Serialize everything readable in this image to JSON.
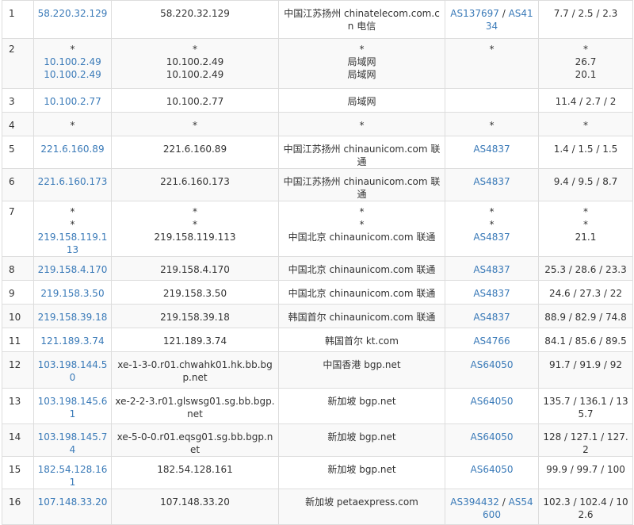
{
  "rows": [
    {
      "hop": "1",
      "ips": [
        "58.220.32.129"
      ],
      "hosts": [
        "58.220.32.129"
      ],
      "locs": [
        "中国江苏扬州 chinatelecom.com.cn 电信"
      ],
      "asns": [
        [
          "AS137697",
          "AS4134"
        ]
      ],
      "rtts": [
        "7.7 / 2.5 / 2.3"
      ]
    },
    {
      "hop": "2",
      "ips": [
        "*",
        "10.100.2.49",
        "10.100.2.49"
      ],
      "hosts": [
        "*",
        "10.100.2.49",
        "10.100.2.49"
      ],
      "locs": [
        "*",
        "局域网",
        "局域网"
      ],
      "asns": [
        [
          "*"
        ]
      ],
      "rtts": [
        "*",
        "26.7",
        "20.1"
      ]
    },
    {
      "hop": "3",
      "ips": [
        "10.100.2.77"
      ],
      "hosts": [
        "10.100.2.77"
      ],
      "locs": [
        "局域网"
      ],
      "asns": [],
      "rtts": [
        "11.4 / 2.7 / 2"
      ]
    },
    {
      "hop": "4",
      "ips": [
        "*"
      ],
      "hosts": [
        "*"
      ],
      "locs": [
        "*"
      ],
      "asns": [
        [
          "*"
        ]
      ],
      "rtts": [
        "*"
      ]
    },
    {
      "hop": "5",
      "ips": [
        "221.6.160.89"
      ],
      "hosts": [
        "221.6.160.89"
      ],
      "locs": [
        "中国江苏扬州 chinaunicom.com 联通"
      ],
      "asns": [
        [
          "AS4837"
        ]
      ],
      "rtts": [
        "1.4 / 1.5 / 1.5"
      ]
    },
    {
      "hop": "6",
      "ips": [
        "221.6.160.173"
      ],
      "hosts": [
        "221.6.160.173"
      ],
      "locs": [
        "中国江苏扬州 chinaunicom.com 联通"
      ],
      "asns": [
        [
          "AS4837"
        ]
      ],
      "rtts": [
        "9.4 / 9.5 / 8.7"
      ]
    },
    {
      "hop": "7",
      "ips": [
        "*",
        "*",
        "219.158.119.113"
      ],
      "hosts": [
        "*",
        "*",
        "219.158.119.113"
      ],
      "locs": [
        "*",
        "*",
        "中国北京 chinaunicom.com 联通"
      ],
      "asns": [
        [
          "*"
        ],
        [
          "*"
        ],
        [
          "AS4837"
        ]
      ],
      "rtts": [
        "*",
        "*",
        "21.1"
      ]
    },
    {
      "hop": "8",
      "ips": [
        "219.158.4.170"
      ],
      "hosts": [
        "219.158.4.170"
      ],
      "locs": [
        "中国北京 chinaunicom.com 联通"
      ],
      "asns": [
        [
          "AS4837"
        ]
      ],
      "rtts": [
        "25.3 / 28.6 / 23.3"
      ]
    },
    {
      "hop": "9",
      "ips": [
        "219.158.3.50"
      ],
      "hosts": [
        "219.158.3.50"
      ],
      "locs": [
        "中国北京 chinaunicom.com 联通"
      ],
      "asns": [
        [
          "AS4837"
        ]
      ],
      "rtts": [
        "24.6 / 27.3 / 22"
      ]
    },
    {
      "hop": "10",
      "ips": [
        "219.158.39.18"
      ],
      "hosts": [
        "219.158.39.18"
      ],
      "locs": [
        "韩国首尔 chinaunicom.com 联通"
      ],
      "asns": [
        [
          "AS4837"
        ]
      ],
      "rtts": [
        "88.9 / 82.9 / 74.8"
      ]
    },
    {
      "hop": "11",
      "ips": [
        "121.189.3.74"
      ],
      "hosts": [
        "121.189.3.74"
      ],
      "locs": [
        "韩国首尔 kt.com"
      ],
      "asns": [
        [
          "AS4766"
        ]
      ],
      "rtts": [
        "84.1 / 85.6 / 89.5"
      ]
    },
    {
      "hop": "12",
      "ips": [
        "103.198.144.50"
      ],
      "hosts": [
        "xe-1-3-0.r01.chwahk01.hk.bb.bgp.net"
      ],
      "locs": [
        "中国香港 bgp.net"
      ],
      "asns": [
        [
          "AS64050"
        ]
      ],
      "rtts": [
        "91.7 / 91.9 / 92"
      ]
    },
    {
      "hop": "13",
      "ips": [
        "103.198.145.61"
      ],
      "hosts": [
        "xe-2-2-3.r01.glswsg01.sg.bb.bgp.net"
      ],
      "locs": [
        "新加坡 bgp.net"
      ],
      "asns": [
        [
          "AS64050"
        ]
      ],
      "rtts": [
        "135.7 / 136.1 / 135.7"
      ]
    },
    {
      "hop": "14",
      "ips": [
        "103.198.145.74"
      ],
      "hosts": [
        "xe-5-0-0.r01.eqsg01.sg.bb.bgp.net"
      ],
      "locs": [
        "新加坡 bgp.net"
      ],
      "asns": [
        [
          "AS64050"
        ]
      ],
      "rtts": [
        "128 / 127.1 / 127.2"
      ]
    },
    {
      "hop": "15",
      "ips": [
        "182.54.128.161"
      ],
      "hosts": [
        "182.54.128.161"
      ],
      "locs": [
        "新加坡 bgp.net"
      ],
      "asns": [
        [
          "AS64050"
        ]
      ],
      "rtts": [
        "99.9 / 99.7 / 100"
      ]
    },
    {
      "hop": "16",
      "ips": [
        "107.148.33.20"
      ],
      "hosts": [
        "107.148.33.20"
      ],
      "locs": [
        "新加坡 petaexpress.com"
      ],
      "asns": [
        [
          "AS394432",
          "AS54600"
        ]
      ],
      "rtts": [
        "102.3 / 102.4 / 102.6"
      ]
    }
  ]
}
